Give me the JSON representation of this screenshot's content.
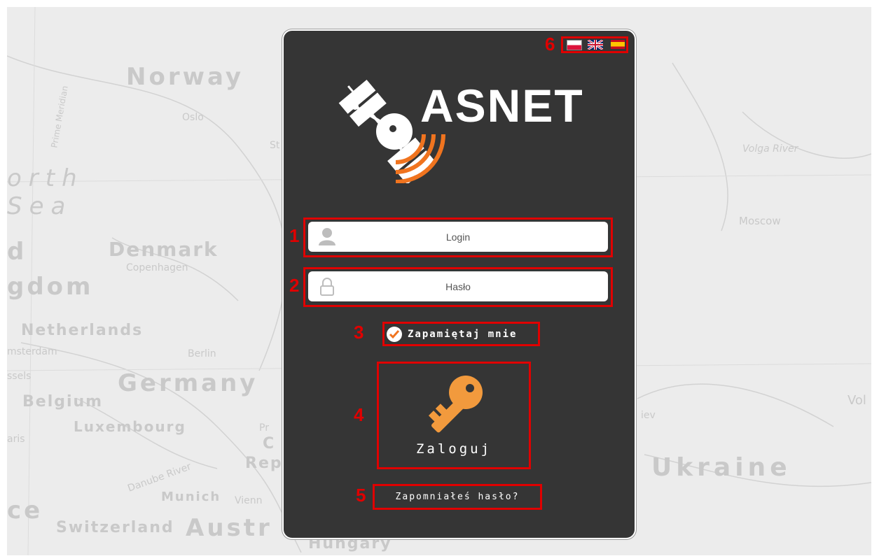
{
  "map": {
    "labels": {
      "norway": "Norway",
      "oslo": "Oslo",
      "north": "orth",
      "sea": "Sea",
      "denmark": "Denmark",
      "copenhagen": "Copenhagen",
      "uk_part1": "d",
      "uk_part2": "gdom",
      "netherlands": "Netherlands",
      "amsterdam": "msterdam",
      "berlin": "Berlin",
      "brussels": "ssels",
      "germany": "Germany",
      "belgium": "Belgium",
      "luxembourg": "Luxembourg",
      "paris": "aris",
      "danube": "Danube River",
      "munich": "Munich",
      "vienna": "Vienn",
      "france": "ce",
      "switzerland": "Switzerland",
      "austria": "Austr",
      "hungary": "Hungary",
      "moscow": "Moscow",
      "volga": "Volga River",
      "ukraine": "Ukraine",
      "kiev": "iev",
      "vol": "Vol",
      "st": "St",
      "prime_meridian": "Prime Meridian",
      "prague_pr": "Pr",
      "prague_c": "C",
      "rep": "Rep"
    }
  },
  "panel": {
    "logo_text": "ASNET",
    "brand_colors": {
      "panel": "#353535",
      "accent": "#f0741f",
      "key": "#f29a3d",
      "highlight": "#e00000"
    }
  },
  "languages": [
    {
      "code": "pl",
      "icon": "poland-flag-icon"
    },
    {
      "code": "en",
      "icon": "uk-flag-icon"
    },
    {
      "code": "es",
      "icon": "spain-flag-icon"
    }
  ],
  "form": {
    "login_placeholder": "Login",
    "password_placeholder": "Hasło",
    "remember_label": "Zapamiętaj mnie",
    "remember_checked": true,
    "submit_label": "Zaloguj",
    "forgot_label": "Zapomniałeś hasło?"
  },
  "annotations": [
    "1",
    "2",
    "3",
    "4",
    "5",
    "6"
  ]
}
